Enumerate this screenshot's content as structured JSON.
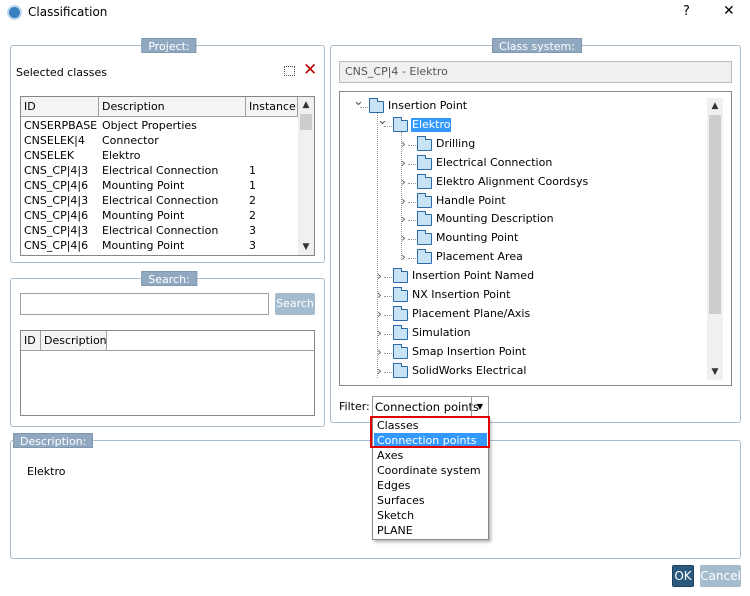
{
  "window": {
    "title": "Classification",
    "help": "?",
    "close": "✕",
    "icon": "app-icon"
  },
  "project": {
    "label": "Project:",
    "selected_classes": "Selected classes",
    "icons": [
      "new-item-icon",
      "delete-icon"
    ],
    "columns": [
      "ID",
      "Description",
      "Instance"
    ],
    "rows": [
      {
        "id": "CNSERPBASE",
        "description": "Object Properties",
        "instance": ""
      },
      {
        "id": "CNSELEK|4",
        "description": "Connector",
        "instance": ""
      },
      {
        "id": "CNSELEK",
        "description": "Elektro",
        "instance": ""
      },
      {
        "id": "CNS_CP|4|3",
        "description": "Electrical Connection",
        "instance": "1"
      },
      {
        "id": "CNS_CP|4|6",
        "description": "Mounting Point",
        "instance": "1"
      },
      {
        "id": "CNS_CP|4|3",
        "description": "Electrical Connection",
        "instance": "2"
      },
      {
        "id": "CNS_CP|4|6",
        "description": "Mounting Point",
        "instance": "2"
      },
      {
        "id": "CNS_CP|4|3",
        "description": "Electrical Connection",
        "instance": "3"
      },
      {
        "id": "CNS_CP|4|6",
        "description": "Mounting Point",
        "instance": "3"
      }
    ]
  },
  "search": {
    "label": "Search:",
    "value": "",
    "button": "Search",
    "columns": [
      "ID",
      "Description"
    ]
  },
  "class_system": {
    "label": "Class system:",
    "path": "CNS_CP|4 - Elektro",
    "tree": [
      {
        "label": "Insertion Point",
        "level": 0,
        "expanded": true
      },
      {
        "label": "Elektro",
        "level": 1,
        "expanded": true,
        "selected": true
      },
      {
        "label": "Drilling",
        "level": 2
      },
      {
        "label": "Electrical Connection",
        "level": 2
      },
      {
        "label": "Elektro Alignment Coordsys",
        "level": 2
      },
      {
        "label": "Handle Point",
        "level": 2
      },
      {
        "label": "Mounting Description",
        "level": 2
      },
      {
        "label": "Mounting Point",
        "level": 2
      },
      {
        "label": "Placement Area",
        "level": 2
      },
      {
        "label": "Insertion Point Named",
        "level": 1
      },
      {
        "label": "NX Insertion Point",
        "level": 1
      },
      {
        "label": "Placement Plane/Axis",
        "level": 1
      },
      {
        "label": "Simulation",
        "level": 1
      },
      {
        "label": "Smap Insertion Point",
        "level": 1
      },
      {
        "label": "SolidWorks Electrical",
        "level": 1
      }
    ],
    "filter_label": "Filter:",
    "filter_value": "Connection points",
    "filter_options": [
      "Classes",
      "Connection points",
      "Axes",
      "Coordinate system",
      "Edges",
      "Surfaces",
      "Sketch",
      "PLANE"
    ],
    "highlighted_option": "Connection points"
  },
  "description": {
    "label": "Description:",
    "text": "Elektro"
  },
  "buttons": {
    "ok": "OK",
    "cancel": "Cancel"
  },
  "colors": {
    "accent": "#3399ff",
    "highlight_box": "#e00000",
    "ok_bg": "#2c5a7e",
    "cancel_bg": "#a4bccf",
    "group_label": "#90a9c0"
  }
}
